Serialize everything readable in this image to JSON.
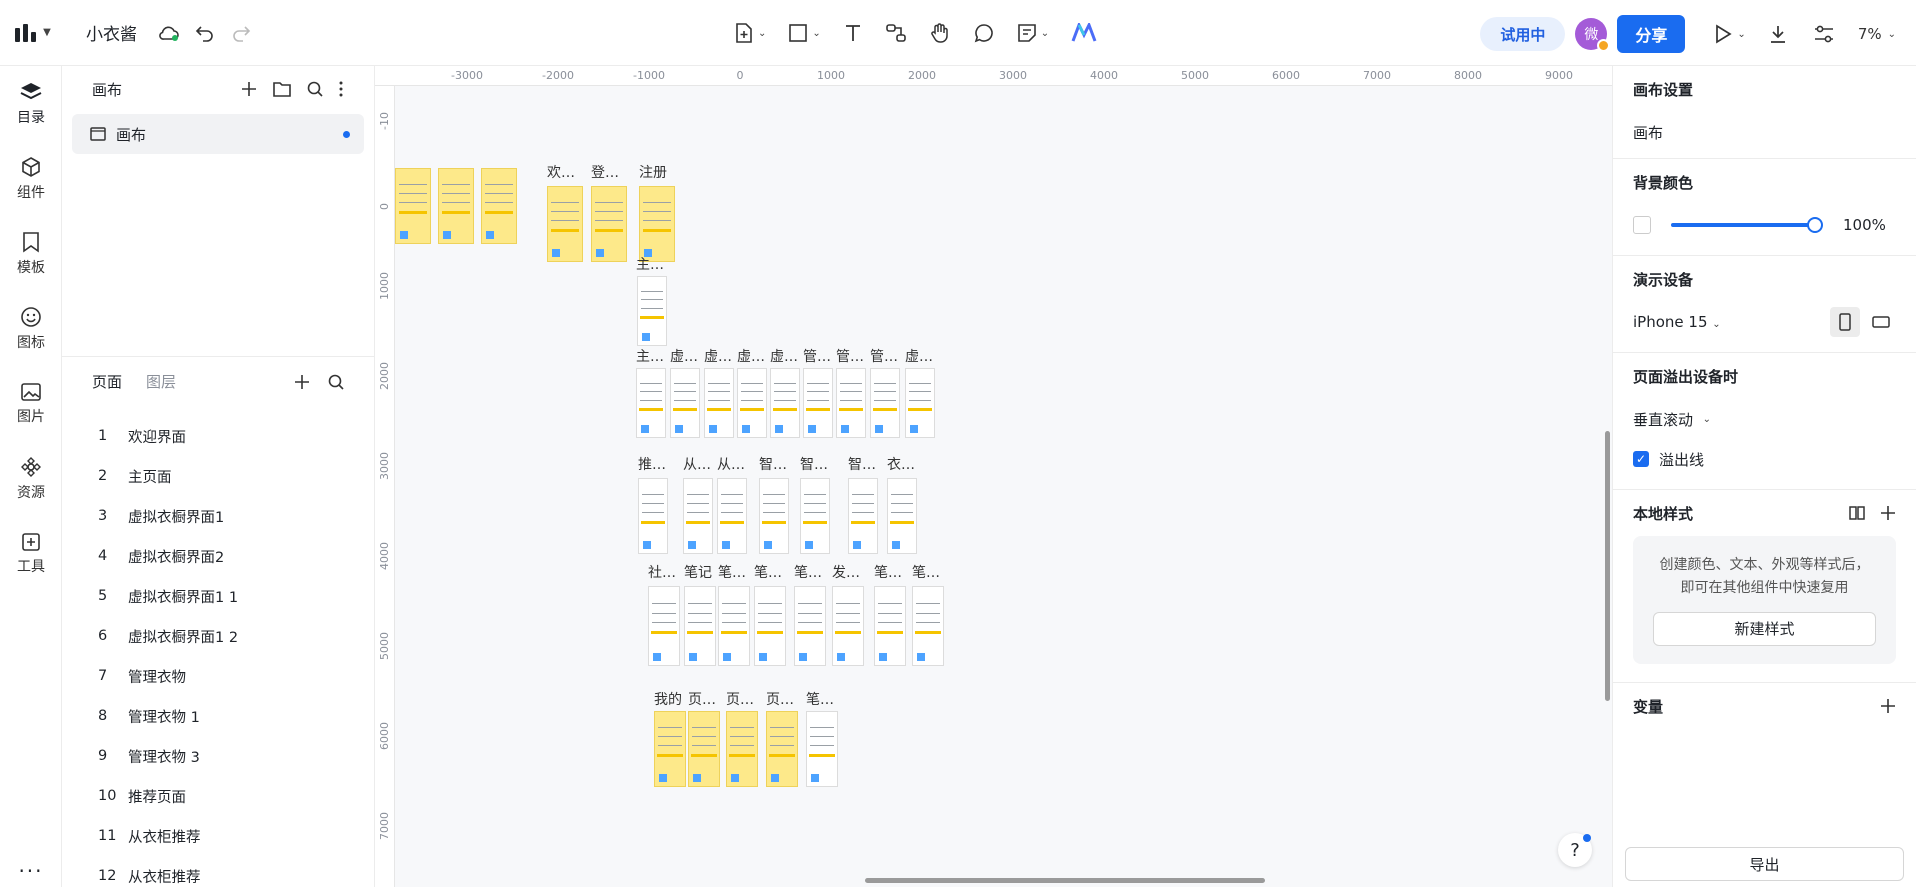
{
  "header": {
    "doc_title": "小衣酱",
    "trial_label": "试用中",
    "avatar_text": "微",
    "share_label": "分享",
    "zoom": "7%"
  },
  "rail": {
    "items": [
      {
        "label": "目录",
        "icon": "layers-icon"
      },
      {
        "label": "组件",
        "icon": "component-icon"
      },
      {
        "label": "模板",
        "icon": "template-icon"
      },
      {
        "label": "图标",
        "icon": "smile-icon"
      },
      {
        "label": "图片",
        "icon": "image-icon"
      },
      {
        "label": "资源",
        "icon": "resource-icon"
      },
      {
        "label": "工具",
        "icon": "plus-square-icon"
      }
    ],
    "more": "..."
  },
  "left_panel": {
    "section_title": "画布",
    "canvas_item": "画布",
    "tab_pages": "页面",
    "tab_layers": "图层",
    "pages": [
      {
        "num": "1",
        "name": "欢迎界面"
      },
      {
        "num": "2",
        "name": "主页面"
      },
      {
        "num": "3",
        "name": "虚拟衣橱界面1"
      },
      {
        "num": "4",
        "name": "虚拟衣橱界面2"
      },
      {
        "num": "5",
        "name": "虚拟衣橱界面1 1"
      },
      {
        "num": "6",
        "name": "虚拟衣橱界面1 2"
      },
      {
        "num": "7",
        "name": "管理衣物"
      },
      {
        "num": "8",
        "name": "管理衣物 1"
      },
      {
        "num": "9",
        "name": "管理衣物 3"
      },
      {
        "num": "10",
        "name": "推荐页面"
      },
      {
        "num": "11",
        "name": "从衣柜推荐"
      },
      {
        "num": "12",
        "name": "从衣柜推荐"
      }
    ]
  },
  "canvas": {
    "ruler_h": [
      "-3000",
      "-2000",
      "-1000",
      "0",
      "1000",
      "2000",
      "3000",
      "4000",
      "5000",
      "6000",
      "7000",
      "8000",
      "9000"
    ],
    "ruler_v": [
      "-10",
      "0",
      "1000",
      "2000",
      "3000",
      "4000",
      "5000",
      "6000",
      "7000"
    ],
    "labels": {
      "r1": [
        "欢…",
        "登…",
        "注册"
      ],
      "r2": [
        "主…"
      ],
      "r3": [
        "主…",
        "虚…",
        "虚…",
        "虚…",
        "虚…",
        "管…",
        "管…",
        "管…",
        "虚…"
      ],
      "r4": [
        "推…",
        "从…",
        "从…",
        "智…",
        "智…",
        "智…",
        "衣…"
      ],
      "r5": [
        "社…",
        "笔记",
        "笔…",
        "笔…",
        "笔…",
        "发…",
        "笔…",
        "笔…"
      ],
      "r6": [
        "我的",
        "页…",
        "页…",
        "页…",
        "笔…"
      ]
    },
    "help": "?"
  },
  "right_panel": {
    "canvas_settings_title": "画布设置",
    "canvas_name": "画布",
    "bg_color_title": "背景颜色",
    "bg_opacity": "100%",
    "device_title": "演示设备",
    "device_value": "iPhone 15",
    "overflow_title": "页面溢出设备时",
    "overflow_value": "垂直滚动",
    "overflow_line_label": "溢出线",
    "local_styles_title": "本地样式",
    "local_styles_desc": "创建颜色、文本、外观等样式后，即可在其他组件中快速复用",
    "new_style_label": "新建样式",
    "variables_title": "变量",
    "export_label": "导出"
  },
  "colors": {
    "accent": "#1a6cf0",
    "frame_yellow": "#fde98a"
  }
}
